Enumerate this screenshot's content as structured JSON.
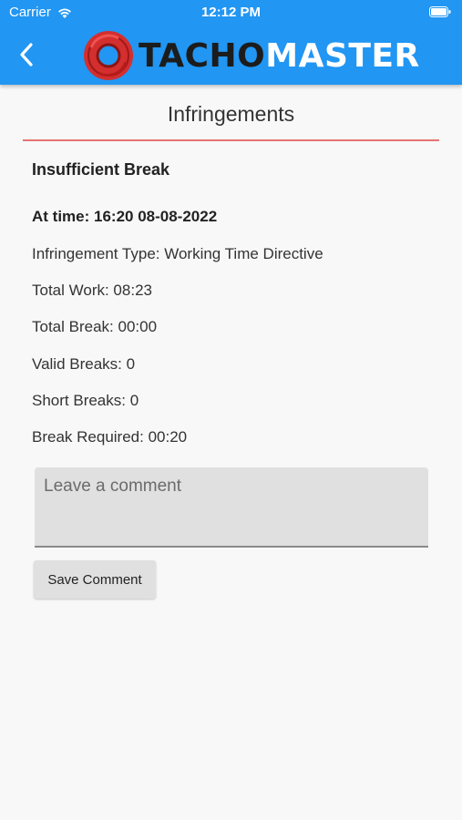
{
  "status_bar": {
    "carrier": "Carrier",
    "time": "12:12 PM"
  },
  "header": {
    "logo_text_dark": "TACHO",
    "logo_text_light": "MASTER",
    "bar_color": "#2196f3",
    "logo_accent": "#d32f2f"
  },
  "page": {
    "title": "Infringements"
  },
  "infringement": {
    "heading": "Insufficient Break",
    "time": "At time: 16:20 08-08-2022",
    "type": "Infringement Type: Working Time Directive",
    "total_work": "Total Work: 08:23",
    "total_break": "Total Break: 00:00",
    "valid_breaks": "Valid Breaks: 0",
    "short_breaks": "Short Breaks: 0",
    "break_required": "Break Required: 00:20"
  },
  "comment": {
    "placeholder": "Leave a comment",
    "value": "",
    "save_label": "Save Comment"
  },
  "icons": {
    "back": "chevron-left-icon",
    "wifi": "wifi-icon",
    "battery": "battery-icon"
  }
}
